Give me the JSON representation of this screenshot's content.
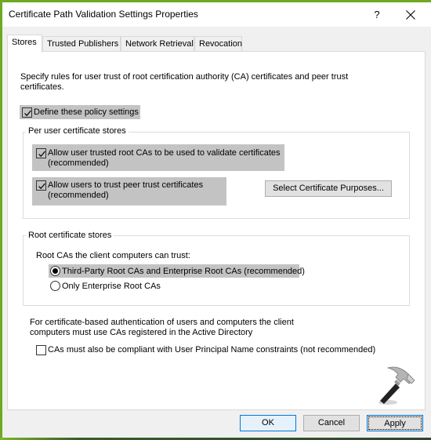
{
  "window": {
    "title": "Certificate Path Validation Settings Properties",
    "help_label": "?",
    "close_icon": "close-icon"
  },
  "tabs": [
    {
      "label": "Stores",
      "active": true
    },
    {
      "label": "Trusted Publishers",
      "active": false
    },
    {
      "label": "Network Retrieval",
      "active": false
    },
    {
      "label": "Revocation",
      "active": false
    }
  ],
  "stores": {
    "description": "Specify rules for user trust of root certification authority (CA) certificates and peer trust certificates.",
    "define_policy": {
      "label": "Define these policy settings",
      "checked": true
    },
    "per_user_group": {
      "title": "Per user certificate stores",
      "allow_root_cas": {
        "line1": "Allow user trusted root CAs to be used to validate certificates",
        "line2": "(recommended)",
        "checked": true
      },
      "allow_peer_trust": {
        "line1": "Allow users to trust peer trust certificates",
        "line2": "(recommended)",
        "checked": true
      },
      "select_purposes_button": "Select Certificate Purposes..."
    },
    "root_group": {
      "title": "Root certificate stores",
      "prompt": "Root CAs the client computers can trust:",
      "options": [
        {
          "label": "Third-Party Root CAs and Enterprise Root CAs (recommended)",
          "selected": true
        },
        {
          "label": "Only Enterprise Root CAs",
          "selected": false
        }
      ]
    },
    "auth_note_line1": "For certificate-based authentication of users and computers the client",
    "auth_note_line2": "computers must use CAs registered in the Active Directory",
    "upn_constraint": {
      "label": "CAs must also be compliant with User Principal Name constraints (not recommended)",
      "checked": false
    }
  },
  "footer": {
    "ok": "OK",
    "cancel": "Cancel",
    "apply": "Apply"
  },
  "watermark_icon": "hammer-icon"
}
